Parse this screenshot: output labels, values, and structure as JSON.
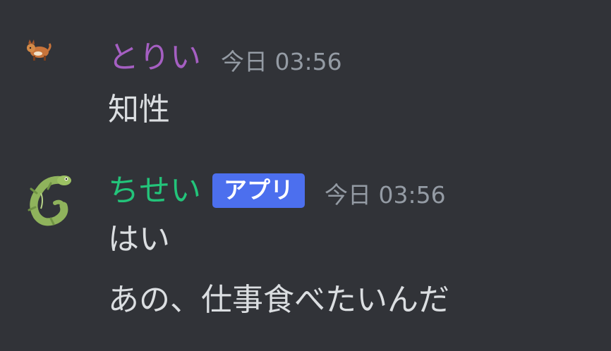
{
  "messages": [
    {
      "username": "とりい",
      "username_color": "#a55fc2",
      "avatar_icon": "fox-avatar-icon",
      "timestamp": "今日 03:56",
      "lines": [
        "知性"
      ]
    },
    {
      "username": "ちせい",
      "username_color": "#23c47a",
      "avatar_icon": "lizard-avatar-icon",
      "badge": "アプリ",
      "timestamp": "今日 03:56",
      "lines": [
        "はい",
        "あの、仕事食べたいんだ"
      ]
    }
  ]
}
